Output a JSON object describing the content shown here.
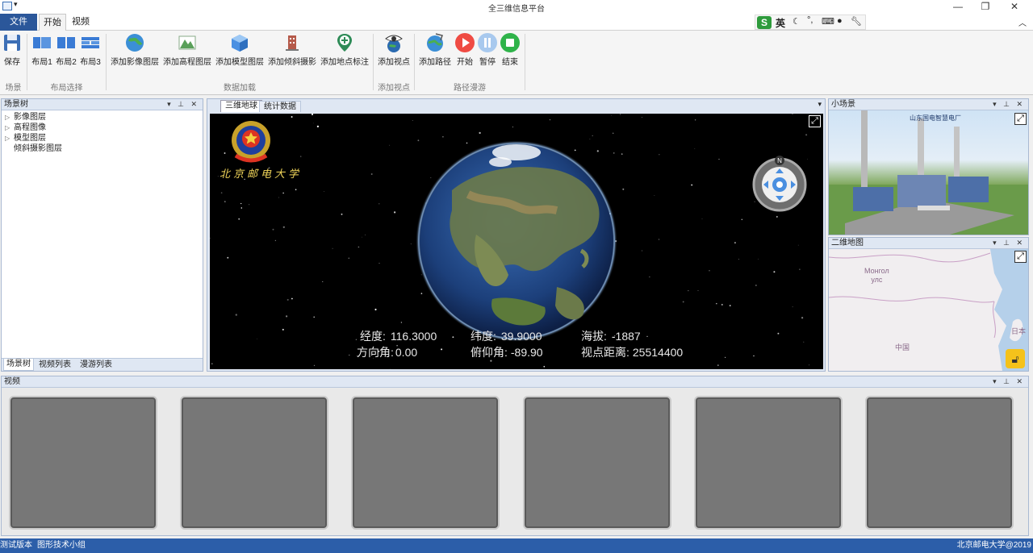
{
  "window": {
    "title": "全三维信息平台",
    "app_menu_icon": "app-icon",
    "controls": [
      "—",
      "❐",
      "✕"
    ]
  },
  "ime_toolbar": {
    "lang": "英",
    "icons": [
      "sogou-s-icon",
      "moon-icon",
      "punctuation-icon",
      "keyboard-icon",
      "user-icon",
      "wrench-icon"
    ]
  },
  "ribbon": {
    "tabs": {
      "file": "文件",
      "home": "开始",
      "video": "视频"
    },
    "buttons": {
      "save": "保存",
      "layout1": "布局1",
      "layout2": "布局2",
      "layout3": "布局3",
      "add_image_layer": "添加影像图层",
      "add_elevation_layer": "添加高程图层",
      "add_model_layer": "添加模型图层",
      "add_oblique": "添加倾斜摄影",
      "add_placemark": "添加地点标注",
      "add_viewpoint": "添加视点",
      "add_path": "添加路径",
      "start": "开始",
      "pause": "暂停",
      "end": "结束"
    },
    "groups": {
      "scene": "场景",
      "layout": "布局选择",
      "data_load": "数据加载",
      "add_view": "添加视点",
      "path_roam": "路径漫游"
    }
  },
  "scene_tree": {
    "title": "场景树",
    "items": [
      "影像图层",
      "高程图像",
      "模型图层",
      "倾斜摄影图层"
    ],
    "bottom_tabs": [
      "场景树",
      "视频列表",
      "漫游列表"
    ]
  },
  "center": {
    "tabs": [
      "三维地球",
      "统计数据"
    ],
    "logo_text": "北京邮电大学",
    "compass_n": "N",
    "readout": {
      "lon_label": "经度:",
      "lon": "116.3000",
      "lat_label": "纬度:",
      "lat": "39.9000",
      "alt_label": "海拔:",
      "alt": "-1887",
      "heading_label": "方向角:",
      "heading": "0.00",
      "pitch_label": "俯仰角:",
      "pitch": "-89.90",
      "dist_label": "视点距离:",
      "dist": "25514400"
    }
  },
  "mini_scene": {
    "title": "小场景",
    "caption": "山东国电智慧电厂"
  },
  "map2d": {
    "title": "二维地图",
    "labels": {
      "mongolia": "Монгол\nулс",
      "china": "中国",
      "japan": "日本"
    }
  },
  "video": {
    "title": "视频",
    "slots": 6
  },
  "status": {
    "left": "测试版本",
    "middle": "图形技术小组",
    "right": "北京邮电大学@2019"
  },
  "colors": {
    "accent": "#2b579a",
    "status_bar": "#2c5ea9",
    "panel_header": "#dfe7f3"
  }
}
